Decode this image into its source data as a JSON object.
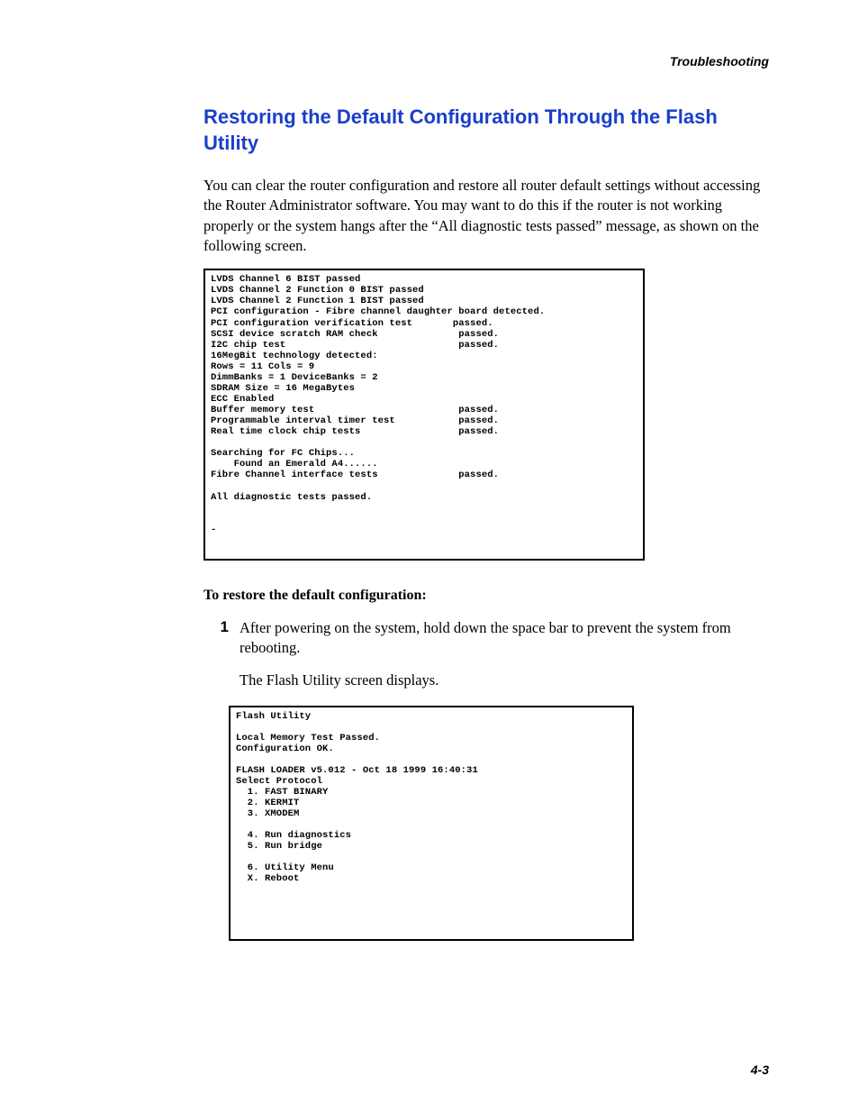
{
  "running_head": "Troubleshooting",
  "title": "Restoring the Default Configuration Through the Flash Utility",
  "intro": "You can clear the router configuration and restore all router default settings without accessing the Router Administrator software. You may want to do this if the router is not working properly or the system hangs after the “All diagnostic tests passed” message, as shown on the following screen.",
  "screenshot1": "LVDS Channel 6 BIST passed\nLVDS Channel 2 Function 0 BIST passed\nLVDS Channel 2 Function 1 BIST passed\nPCI configuration - Fibre channel daughter board detected.\nPCI configuration verification test       passed.\nSCSI device scratch RAM check              passed.\nI2C chip test                              passed.\n16MegBit technology detected:\nRows = 11 Cols = 9\nDimmBanks = 1 DeviceBanks = 2\nSDRAM Size = 16 MegaBytes\nECC Enabled\nBuffer memory test                         passed.\nProgrammable interval timer test           passed.\nReal time clock chip tests                 passed.\n\nSearching for FC Chips...\n    Found an Emerald A4......\nFibre Channel interface tests              passed.\n\nAll diagnostic tests passed.\n\n\n-",
  "sub_head": "To restore the default configuration:",
  "step1_num": "1",
  "step1_text": "After powering on the system, hold down the space bar to prevent the system from rebooting.",
  "step1_follow": "The Flash Utility screen displays.",
  "screenshot2": "Flash Utility\n\nLocal Memory Test Passed.\nConfiguration OK.\n\nFLASH LOADER v5.012 - Oct 18 1999 16:40:31\nSelect Protocol\n  1. FAST BINARY\n  2. KERMIT\n  3. XMODEM\n\n  4. Run diagnostics\n  5. Run bridge\n\n  6. Utility Menu\n  X. Reboot",
  "page_number": "4-3"
}
